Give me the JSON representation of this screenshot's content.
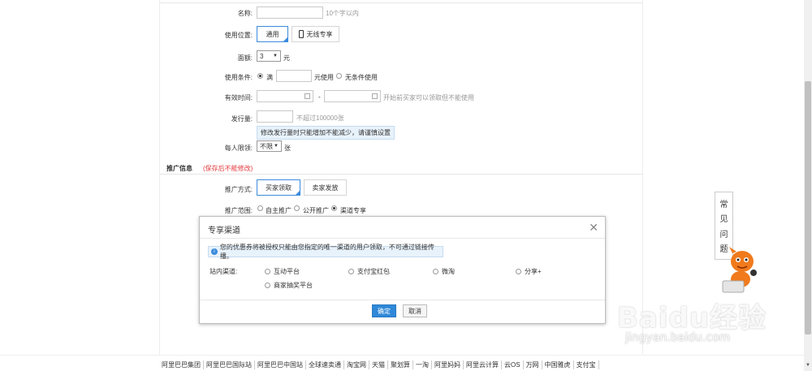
{
  "form": {
    "name": {
      "label": "名称:",
      "hint": "10个字以内",
      "value": ""
    },
    "position": {
      "label": "使用位置:",
      "option_general": "通用",
      "option_wireless": "无线专享"
    },
    "denomination": {
      "label": "面额:",
      "value": "3",
      "unit": "元"
    },
    "condition": {
      "label": "使用条件:",
      "full_label": "满",
      "unit": "元使用",
      "no_condition": "无条件使用"
    },
    "validity": {
      "label": "有效时间:",
      "dash": "-",
      "hint": "开始前买家可以领取但不能使用"
    },
    "issue": {
      "label": "发行量:",
      "hint": "不超过100000张",
      "note": "修改发行量时只能增加不能减少，请谨慎设置"
    },
    "limit": {
      "label": "每人限领:",
      "value": "不限",
      "unit": "张"
    }
  },
  "promotion": {
    "title": "推广信息",
    "warning": "(保存后不能修改)",
    "method": {
      "label": "推广方式:",
      "option_buyer": "买家领取",
      "option_seller": "卖家发放"
    },
    "scope": {
      "label": "推广范围:",
      "option_self": "自主推广",
      "option_public": "公开推广",
      "option_channel": "渠道专享"
    }
  },
  "modal": {
    "title": "专享渠道",
    "info": "您的优惠券将被授权只能由您指定的唯一渠道的用户领取，不可通过链接传播。",
    "channel_label": "站内渠道:",
    "channels": [
      "互动平台",
      "支付宝红包",
      "微淘",
      "分享+",
      "商家抽奖平台"
    ],
    "ok": "确定",
    "cancel": "取消"
  },
  "faq": {
    "chars": [
      "常",
      "见",
      "问",
      "题"
    ]
  },
  "watermark": {
    "main": "Baidu经验",
    "sub": "jingyan.baidu.com"
  },
  "footer": {
    "links": [
      "阿里巴巴集团",
      "阿里巴巴国际站",
      "阿里巴巴中国站",
      "全球速卖通",
      "淘宝网",
      "天猫",
      "聚划算",
      "一淘",
      "阿里妈妈",
      "阿里云计算",
      "云OS",
      "万网",
      "中国雅虎",
      "支付宝"
    ]
  },
  "colors": {
    "accent": "#3b8bdc",
    "warning": "#e4393c",
    "note_bg": "#e8f2fb"
  }
}
